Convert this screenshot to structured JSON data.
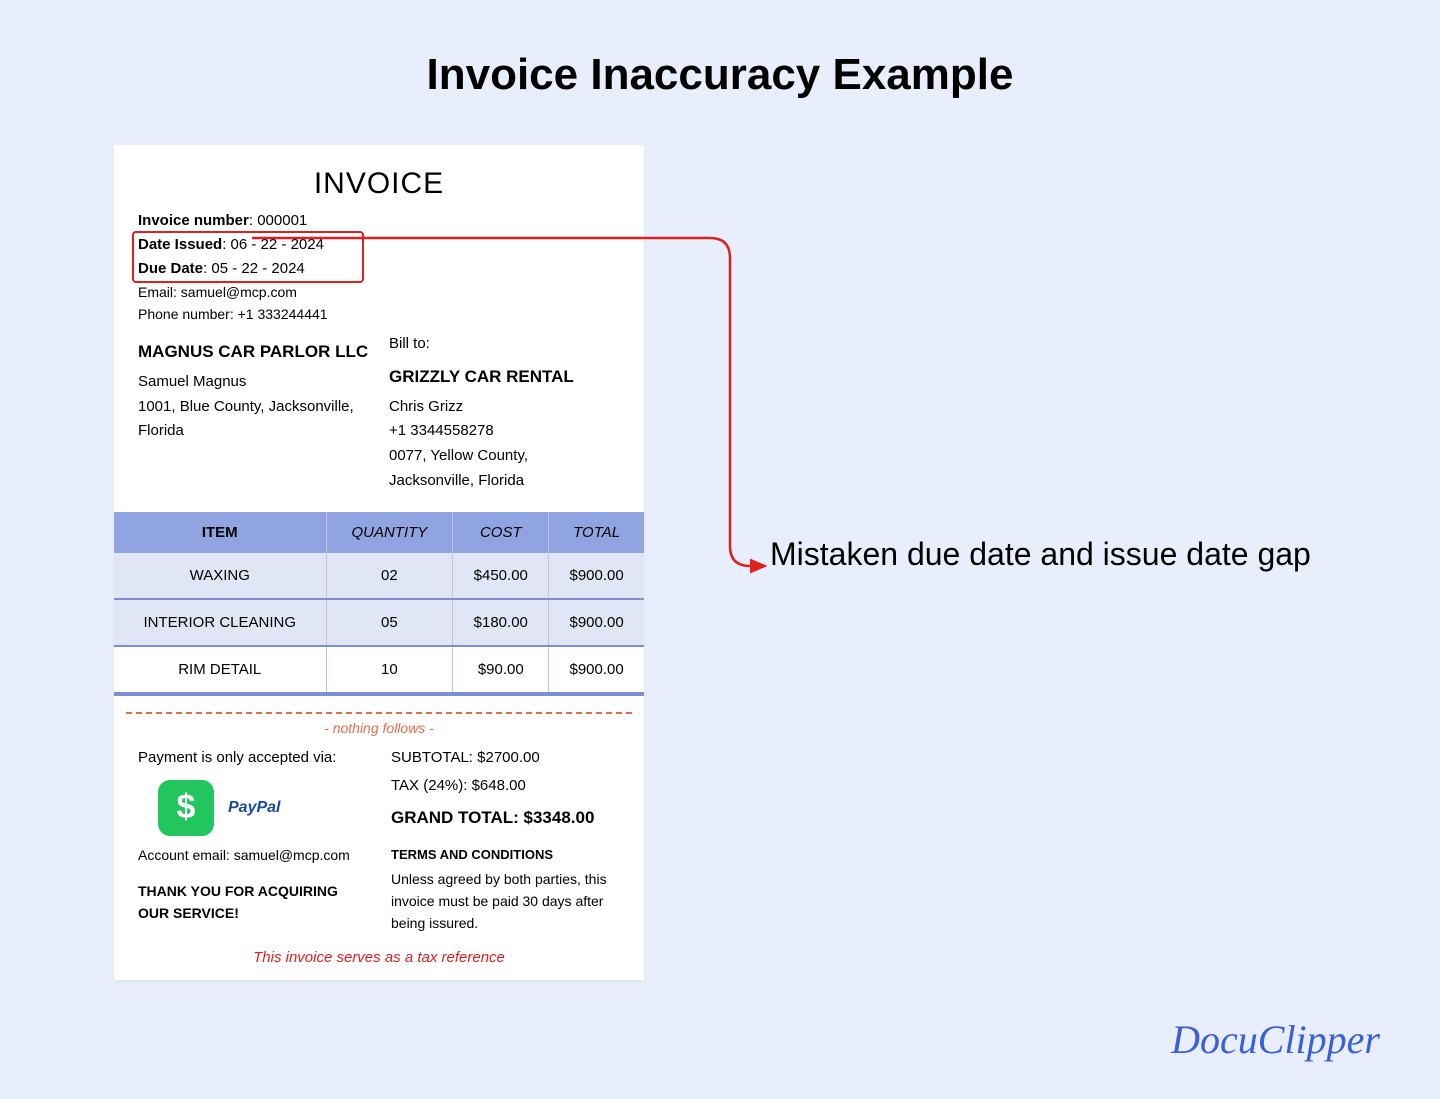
{
  "title": "Invoice Inaccuracy Example",
  "annotation": "Mistaken due date and issue date gap",
  "brand": "DocuClipper",
  "invoice": {
    "header": "INVOICE",
    "meta": {
      "number_label": "Invoice number",
      "number_value": "000001",
      "issued_label": "Date Issued",
      "issued_value": "06 - 22 - 2024",
      "due_label": "Due Date",
      "due_value": "05 - 22 - 2024",
      "email_label": "Email",
      "email_value": "samuel@mcp.com",
      "phone_label": "Phone number",
      "phone_value": "+1 333244441"
    },
    "from": {
      "company": "MAGNUS CAR PARLOR LLC",
      "name": "Samuel Magnus",
      "address1": "1001, Blue County, Jacksonville,",
      "address2": "Florida"
    },
    "billto": {
      "label": "Bill to:",
      "company": "GRIZZLY CAR RENTAL",
      "name": "Chris Grizz",
      "phone": "+1 3344558278",
      "address1": "0077, Yellow County,",
      "address2": "Jacksonville, Florida"
    },
    "table": {
      "headers": [
        "ITEM",
        "QUANTITY",
        "COST",
        "TOTAL"
      ],
      "rows": [
        [
          "WAXING",
          "02",
          "$450.00",
          "$900.00"
        ],
        [
          "INTERIOR CLEANING",
          "05",
          "$180.00",
          "$900.00"
        ],
        [
          "RIM DETAIL",
          "10",
          "$90.00",
          "$900.00"
        ]
      ]
    },
    "nothing_follows": "- nothing follows -",
    "payment": {
      "label": "Payment is only accepted via:",
      "provider": "PayPal",
      "account_label": "Account email: samuel@mcp.com"
    },
    "thankyou": "THANK YOU FOR ACQUIRING OUR SERVICE!",
    "totals": {
      "subtotal": "SUBTOTAL: $2700.00",
      "tax": "TAX (24%): $648.00",
      "grand": "GRAND TOTAL: $3348.00"
    },
    "terms": {
      "header": "TERMS AND CONDITIONS",
      "body": "Unless agreed by both parties, this invoice must be paid 30 days after being issured."
    },
    "tax_ref": "This invoice serves as a tax reference"
  }
}
